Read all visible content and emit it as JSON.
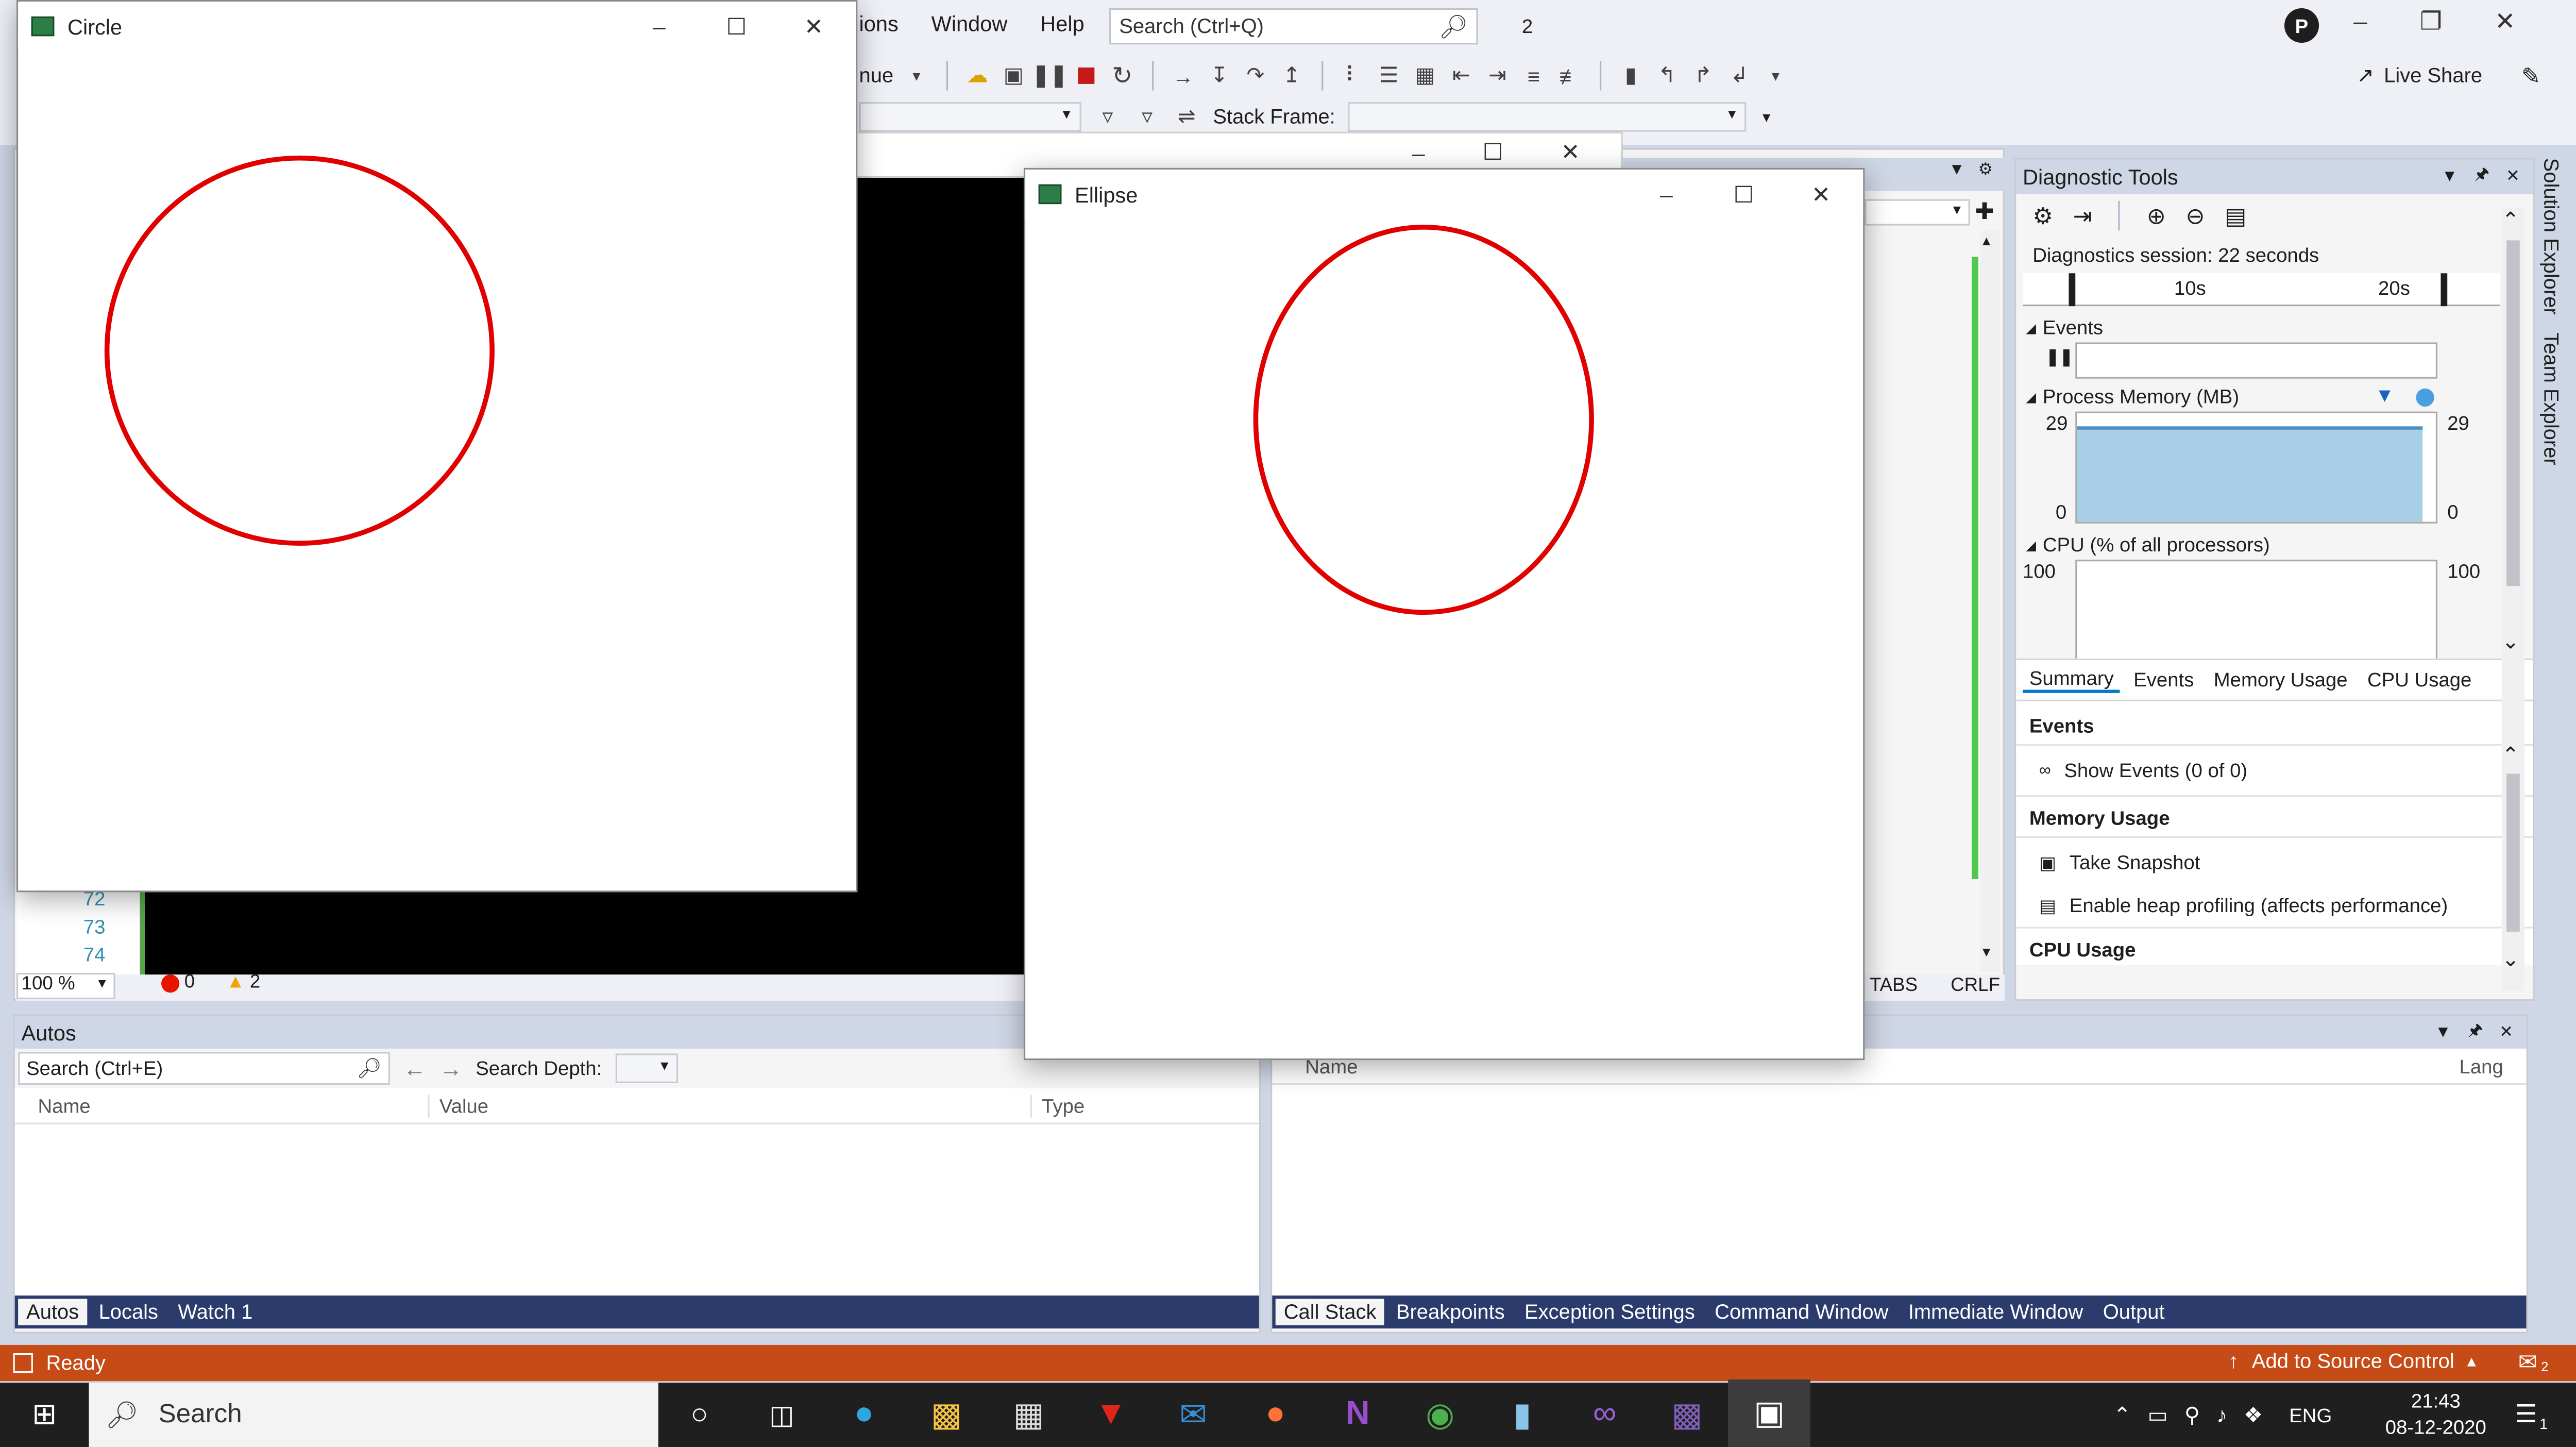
{
  "menu": {
    "partial": "ions",
    "window": "Window",
    "help": "Help",
    "search_placeholder": "Search (Ctrl+Q)",
    "notif": "2",
    "avatar": "P",
    "live_share": "Live Share",
    "continue_partial": "nue",
    "stack_frame": "Stack Frame:"
  },
  "circle_window": {
    "title": "Circle"
  },
  "ellipse_window": {
    "title": "Ellipse"
  },
  "editor": {
    "lines": [
      "72",
      "73",
      "74"
    ],
    "zoom": "100 %",
    "err_count": "0",
    "warn_count": "2",
    "tabs_label": "TABS",
    "crlf_label": "CRLF"
  },
  "diagnostics": {
    "title": "Diagnostic Tools",
    "session": "Diagnostics session: 22 seconds",
    "tick_10": "10s",
    "tick_20": "20s",
    "events_label": "Events",
    "memory_label": "Process Memory (MB)",
    "mem_max_left": "29",
    "mem_min_left": "0",
    "mem_max_right": "29",
    "mem_min_right": "0",
    "cpu_label": "CPU (% of all processors)",
    "cpu_max_left": "100",
    "cpu_max_right": "100",
    "tabs": [
      "Summary",
      "Events",
      "Memory Usage",
      "CPU Usage"
    ],
    "sec_events": "Events",
    "show_events": "Show Events (0 of 0)",
    "sec_memory": "Memory Usage",
    "take_snapshot": "Take Snapshot",
    "heap_profiling": "Enable heap profiling (affects performance)",
    "sec_cpu": "CPU Usage"
  },
  "side_tabs": {
    "solution": "Solution Explorer",
    "team": "Team Explorer"
  },
  "autos": {
    "title": "Autos",
    "search_placeholder": "Search (Ctrl+E)",
    "depth_label": "Search Depth:",
    "col_name": "Name",
    "col_value": "Value",
    "col_type": "Type",
    "tabs": [
      "Autos",
      "Locals",
      "Watch 1"
    ]
  },
  "callstack": {
    "col_name": "Name",
    "col_lang": "Lang",
    "tabs": [
      "Call Stack",
      "Breakpoints",
      "Exception Settings",
      "Command Window",
      "Immediate Window",
      "Output"
    ]
  },
  "status": {
    "ready": "Ready",
    "source_control": "Add to Source Control",
    "bell_count": "2"
  },
  "taskbar": {
    "search": "Search",
    "lang": "ENG",
    "time": "21:43",
    "date": "08-12-2020",
    "notif_count": "1"
  },
  "colors": {
    "vs_purple": "#68217a",
    "status_red": "#ca5100",
    "accent_blue": "#007acc",
    "shape_red": "#e00000"
  }
}
